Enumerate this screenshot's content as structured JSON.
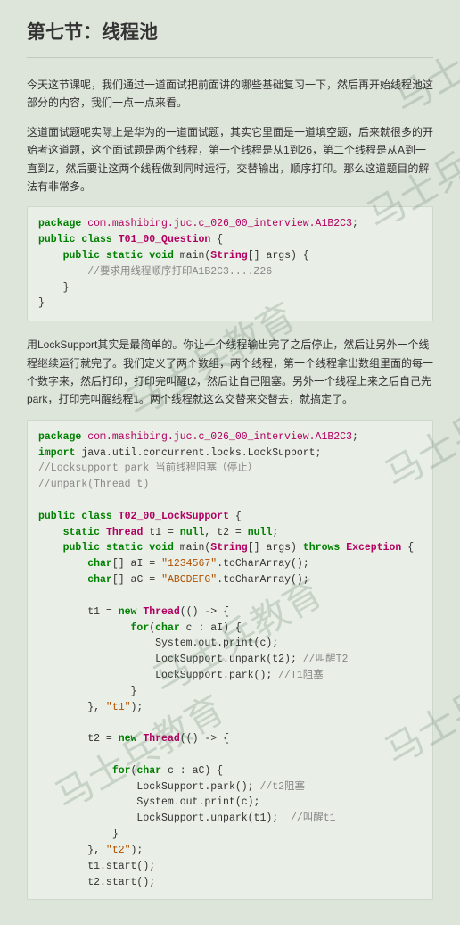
{
  "title": "第七节：线程池",
  "paragraphs": {
    "p1": "今天这节课呢，我们通过一道面试把前面讲的哪些基础复习一下，然后再开始线程池这部分的内容，我们一点一点来看。",
    "p2": "这道面试题呢实际上是华为的一道面试题，其实它里面是一道填空题，后来就很多的开始考这道题，这个面试题是两个线程，第一个线程是从1到26，第二个线程是从A到一直到Z，然后要让这两个线程做到同时运行，交替输出，顺序打印。那么这道题目的解法有非常多。",
    "p3": "用LockSupport其实是最简单的。你让一个线程输出完了之后停止，然后让另外一个线程继续运行就完了。我们定义了两个数组，两个线程，第一个线程拿出数组里面的每一个数字来，然后打印，打印完叫醒t2，然后让自己阻塞。另外一个线程上来之后自己先park，打印完叫醒线程1。两个线程就这么交替来交替去，就搞定了。"
  },
  "code1": {
    "pkg_kw": "package",
    "pkg_name": "com.mashibing.juc.c_026_00_interview.A1B2C3",
    "public": "public",
    "class": "class",
    "class_name": "T01_00_Question",
    "static": "static",
    "void": "void",
    "main": "main",
    "String": "String",
    "args": "args",
    "comment": "//要求用线程顺序打印A1B2C3....Z26"
  },
  "code2": {
    "pkg_kw": "package",
    "pkg_name": "com.mashibing.juc.c_026_00_interview.A1B2C3",
    "import": "import",
    "import_path": "java.util.concurrent.locks.LockSupport",
    "cmt1": "//Locksupport park 当前线程阻塞（停止）",
    "cmt2": "//unpark(Thread t)",
    "public": "public",
    "class": "class",
    "class_name": "T02_00_LockSupport",
    "static": "static",
    "Thread": "Thread",
    "t1": "t1",
    "null": "null",
    "t2": "t2",
    "void": "void",
    "main": "main",
    "String": "String",
    "args": "args",
    "throws": "throws",
    "Exception": "Exception",
    "char": "char",
    "aI": "aI",
    "str_num": "\"1234567\"",
    "toCharArray": ".toCharArray()",
    "aC": "aC",
    "str_abc": "\"ABCDEFG\"",
    "new": "new",
    "for": "for",
    "c": "c",
    "sysout": "System.out.print",
    "ls_unpark_t2": "LockSupport.unpark(t2);",
    "cmt_wake_t2": "//叫醒T2",
    "ls_park": "LockSupport.park();",
    "cmt_t1_block": "//T1阻塞",
    "t1_name": "\"t1\"",
    "cmt_t2_block": "//t2阻塞",
    "ls_unpark_t1": "LockSupport.unpark(t1);",
    "cmt_wake_t1": "//叫醒t1",
    "t2_name": "\"t2\"",
    "t1_start": "t1.start();",
    "t2_start": "t2.start();"
  },
  "watermark_text": "马士兵教育"
}
